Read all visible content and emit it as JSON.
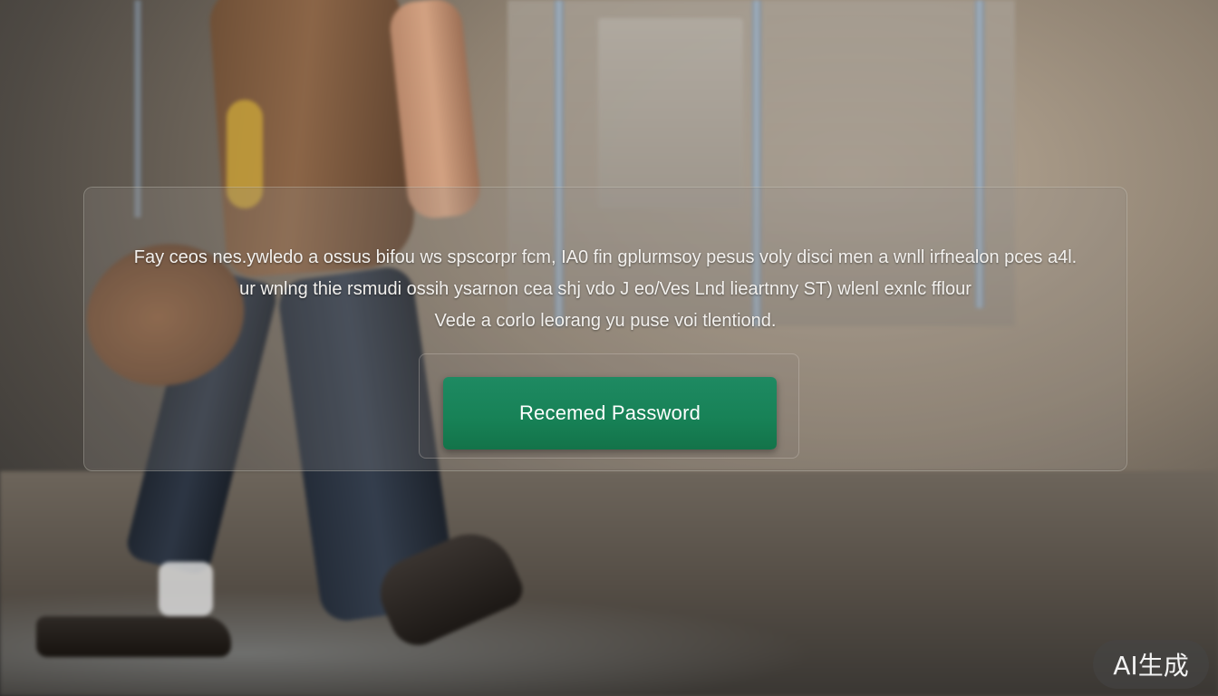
{
  "dialog": {
    "message_lines": [
      "Fay ceos nes.ywledo a ossus bifou ws spscorpr fcm, IA0 fin gplurmsoy pesus voly disci men a wnll irfnealon pces a4l.",
      "ur wnlng thie rsmudi ossih ysarnon cea shj vdo J eo/Ves Lnd lieartnny ST) wlenl exnlc fflour",
      "Vede a corlo leorang yu puse voi tlentiond."
    ],
    "primary_button_label": "Recemed Password"
  },
  "watermark": {
    "text": "AI生成"
  },
  "colors": {
    "button_green": "#178156",
    "message_text": "#f3f1ee"
  }
}
